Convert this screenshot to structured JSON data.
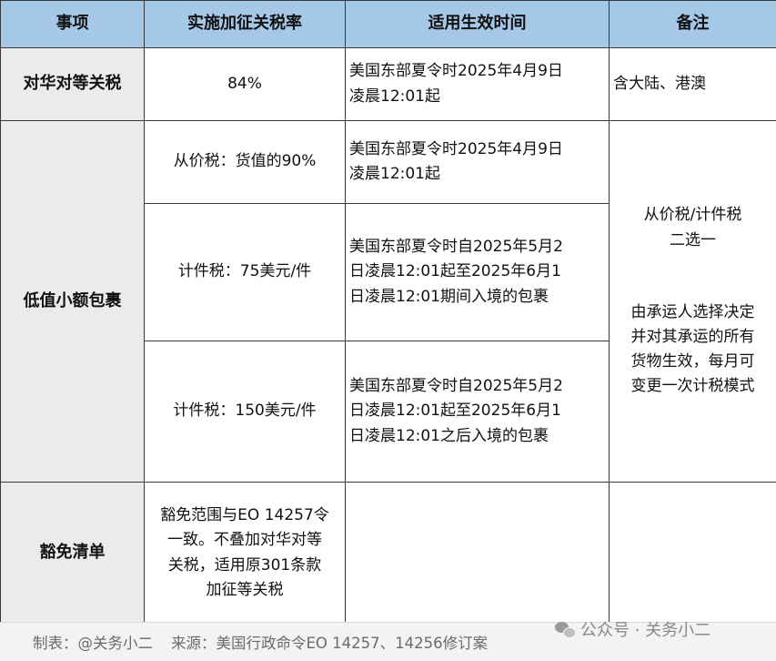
{
  "table": {
    "headers": [
      "事项",
      "实施加征关税率",
      "适用生效时间",
      "备注"
    ],
    "rows": {
      "reciprocal": {
        "item": "对华对等关税",
        "rate": "84%",
        "effective_line1": "美国东部夏令时2025年4月9日",
        "effective_line2": "凌晨12:01起",
        "note": "含大陆、港澳"
      },
      "low_value": {
        "item": "低值小额包裹",
        "sub": [
          {
            "rate": "从价税：货值的90%",
            "effective_line1": "美国东部夏令时2025年4月9日",
            "effective_line2": "凌晨12:01起"
          },
          {
            "rate": "计件税：75美元/件",
            "effective_line1": "美国东部夏令时自2025年5月2",
            "effective_line2": "日凌晨12:01起至2025年6月1",
            "effective_line3": "日凌晨12:01期间入境的包裹"
          },
          {
            "rate": "计件税：150美元/件",
            "effective_line1": "美国东部夏令时自2025年5月2",
            "effective_line2": "日凌晨12:01起至2025年6月1",
            "effective_line3": "日凌晨12:01之后入境的包裹"
          }
        ],
        "note_line1": "从价税/计件税",
        "note_line2": "二选一",
        "note_line3": "由承运人选择决定",
        "note_line4": "并对其承运的所有",
        "note_line5": "货物生效，每月可",
        "note_line6": "变更一次计税模式"
      },
      "exemption": {
        "item": "豁免清单",
        "desc_line1": "豁免范围与EO 14257令",
        "desc_line2": "一致。不叠加对华对等",
        "desc_line3": "关税，适用原301条款",
        "desc_line4": "加征等关税",
        "effective": "",
        "note": ""
      }
    }
  },
  "footer": {
    "maker": "制表：@关务小二",
    "source": "来源：美国行政命令EO 14257、14256修订案"
  },
  "watermark": {
    "text": "公众号 · 关务小二",
    "icon": "wechat-icon"
  }
}
